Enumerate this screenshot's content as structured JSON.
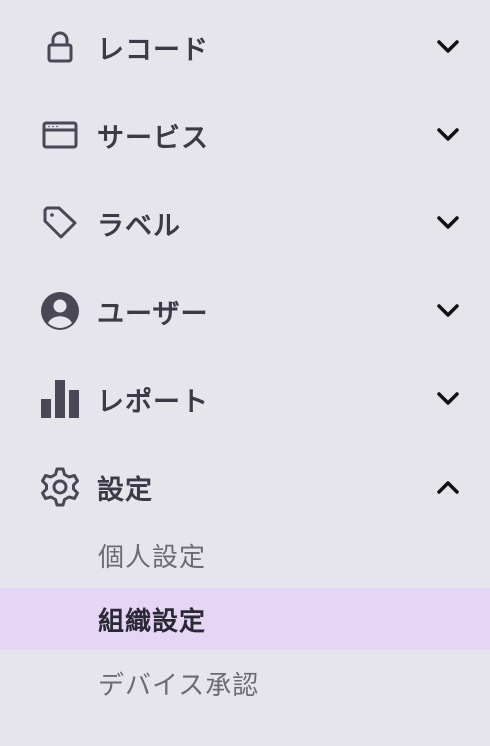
{
  "menu": {
    "items": [
      {
        "label": "レコード",
        "icon": "lock-icon",
        "expanded": false
      },
      {
        "label": "サービス",
        "icon": "browser-window-icon",
        "expanded": false
      },
      {
        "label": "ラベル",
        "icon": "tag-icon",
        "expanded": false
      },
      {
        "label": "ユーザー",
        "icon": "user-circle-icon",
        "expanded": false
      },
      {
        "label": "レポート",
        "icon": "bar-chart-icon",
        "expanded": false
      },
      {
        "label": "設定",
        "icon": "gear-icon",
        "expanded": true
      }
    ],
    "settings_children": [
      {
        "label": "個人設定",
        "active": false
      },
      {
        "label": "組織設定",
        "active": true
      },
      {
        "label": "デバイス承認",
        "active": false
      }
    ]
  },
  "colors": {
    "background": "#e6e5ec",
    "active_background": "#e5d6f6",
    "icon": "#4a4856",
    "chevron": "#111111"
  }
}
